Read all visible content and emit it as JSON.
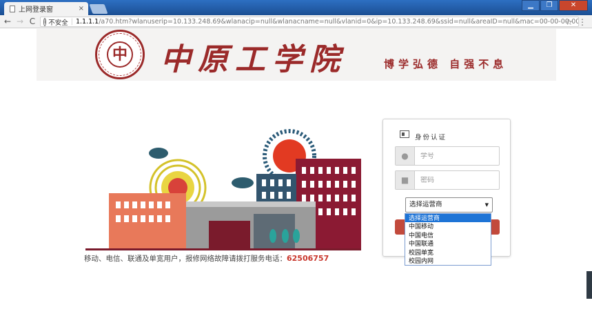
{
  "browser": {
    "tab_title": "上网登录窗",
    "tab_close": "×",
    "window_controls": [
      "▁",
      "❐",
      "✕"
    ],
    "security_label": "不安全",
    "url_host": "1.1.1.1",
    "url_path": "/a70.htm?wlanuserip=10.133.248.69&wlanacip=null&wlanacname=null&vlanid=0&ip=10.133.248.69&ssid=null&areaID=null&mac=00-00-00-00-00-00",
    "back_icon": "←",
    "forward_icon": "→",
    "reload_icon": "C",
    "star_icon": "☆",
    "menu_icon": "⋮"
  },
  "header": {
    "seal_char": "中",
    "school_name": "中原工学院",
    "motto": "博学弘德 自强不息"
  },
  "notice": {
    "text": "移动、电信、联通及单宽用户，报修网络故障请拨打服务电话：",
    "phone": "62506757"
  },
  "login": {
    "title": "身份认证",
    "username_placeholder": "学号",
    "password_placeholder": "密码",
    "carrier_selected": "选择运营商",
    "carrier_arrow": "▼",
    "carrier_options": [
      "选择运营商",
      "中国移动",
      "中国电信",
      "中国联通",
      "校园单宽",
      "校园内网"
    ],
    "user_icon": "👤",
    "lock_icon": "🔒"
  },
  "colors": {
    "brand": "#9b2a2a",
    "button": "#c24a3c",
    "phone": "#c8352b",
    "selected_option": "#1e74d6"
  }
}
